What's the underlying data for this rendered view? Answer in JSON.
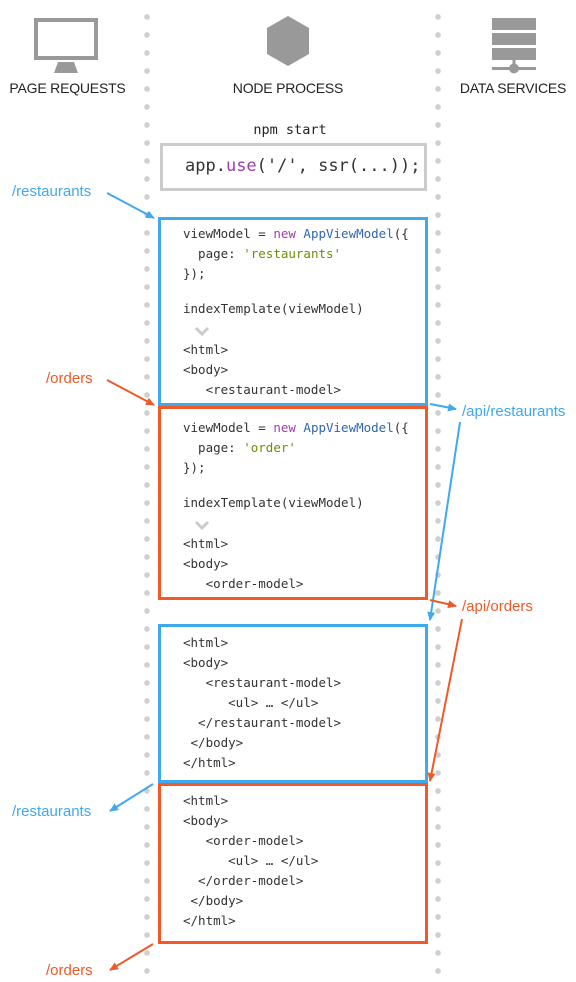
{
  "colors": {
    "blue": "#3fa9f0",
    "orange": "#ef5a28",
    "gray_icon": "#999999",
    "divider": "#cfcfcf",
    "npm_box_border": "#cccccc"
  },
  "columns": [
    {
      "label": "PAGE REQUESTS",
      "icon": "monitor-icon"
    },
    {
      "label": "NODE PROCESS",
      "icon": "hexagon-node-icon"
    },
    {
      "label": "DATA SERVICES",
      "icon": "server-stack-icon"
    }
  ],
  "npm": {
    "command": "npm start",
    "code": {
      "pre": "app.",
      "method": "use",
      "args": "('/', ssr(...));"
    }
  },
  "requests": {
    "restaurants_in": "/restaurants",
    "orders_in": "/orders",
    "restaurants_out": "/restaurants",
    "orders_out": "/orders"
  },
  "services": {
    "api_restaurants": "/api/restaurants",
    "api_orders": "/api/orders"
  },
  "blocks": {
    "restaurants_vm": {
      "l1_a": "viewModel = ",
      "l1_kw": "new",
      "l1_cls": "AppViewModel",
      "l1_b": "({",
      "l2_a": "  page: ",
      "l2_str": "'restaurants'",
      "l3": "});",
      "l4": "indexTemplate(viewModel)",
      "l5": "<html>",
      "l6": "<body>",
      "l7": "   <restaurant-model>"
    },
    "orders_vm": {
      "l1_a": "viewModel = ",
      "l1_kw": "new",
      "l1_cls": "AppViewModel",
      "l1_b": "({",
      "l2_a": "  page: ",
      "l2_str": "'order'",
      "l3": "});",
      "l4": "indexTemplate(viewModel)",
      "l5": "<html>",
      "l6": "<body>",
      "l7": "   <order-model>"
    },
    "restaurants_html": [
      "<html>",
      "<body>",
      "   <restaurant-model>",
      "      <ul> … </ul>",
      "  </restaurant-model>",
      " </body>",
      "</html>"
    ],
    "orders_html": [
      "<html>",
      "<body>",
      "   <order-model>",
      "      <ul> … </ul>",
      "  </order-model>",
      " </body>",
      "</html>"
    ]
  }
}
